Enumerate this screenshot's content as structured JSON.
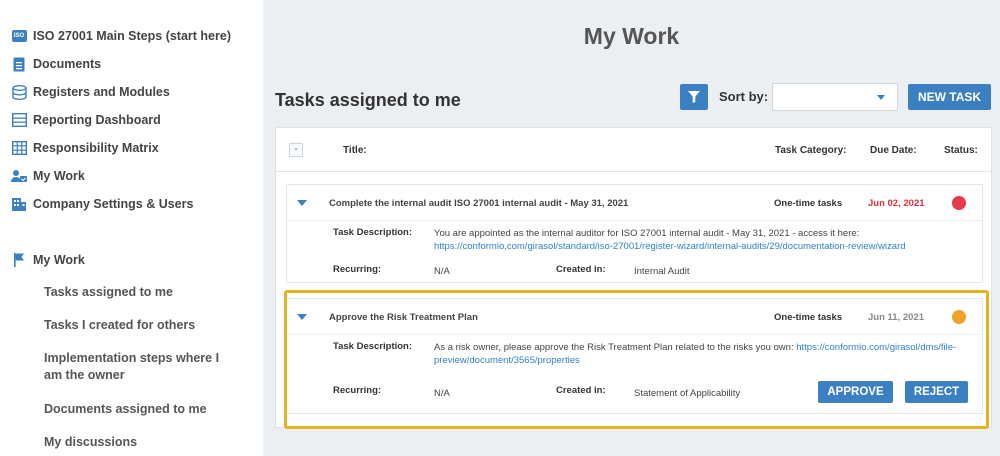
{
  "sidebar": {
    "nav": [
      {
        "label": "ISO 27001 Main Steps (start here)",
        "icon": "iso-badge-icon"
      },
      {
        "label": "Documents",
        "icon": "document-icon"
      },
      {
        "label": "Registers and Modules",
        "icon": "database-icon"
      },
      {
        "label": "Reporting Dashboard",
        "icon": "list-icon"
      },
      {
        "label": "Responsibility Matrix",
        "icon": "grid-icon"
      },
      {
        "label": "My Work",
        "icon": "user-check-icon"
      },
      {
        "label": "Company Settings & Users",
        "icon": "building-icon"
      }
    ],
    "iso_badge": "ISO",
    "section": {
      "label": "My Work",
      "icon": "flag-icon"
    },
    "sub_items": [
      "Tasks assigned to me",
      "Tasks I created for others",
      "Implementation steps where I am the owner",
      "Documents assigned to me",
      "My discussions"
    ]
  },
  "main": {
    "page_title": "My Work",
    "section_title": "Tasks assigned to me",
    "sort_label": "Sort by:",
    "sort_value": "",
    "new_task_label": "NEW TASK",
    "table": {
      "collapse_label": "-",
      "columns": {
        "title": "Title:",
        "category": "Task Category:",
        "due": "Due Date:",
        "status": "Status:"
      }
    },
    "tasks": [
      {
        "title": "Complete the internal audit ISO 27001 internal audit - May 31, 2021",
        "category": "One-time tasks",
        "due": "Jun 02, 2021",
        "due_color": "#e0303a",
        "status_color": "#e8394a",
        "desc_label": "Task Description:",
        "desc_text": "You are appointed as the internal auditor for ISO 27001 internal audit - May 31, 2021 - access it here:",
        "desc_link": "https://conformio.com/girasol/standard/iso-27001/register-wizard/internal-audits/29/documentation-review/wizard",
        "recurring_label": "Recurring:",
        "recurring": "N/A",
        "created_label": "Created in:",
        "created": "Internal Audit"
      },
      {
        "title": "Approve the Risk Treatment Plan",
        "category": "One-time tasks",
        "due": "Jun 11, 2021",
        "due_color": "#888888",
        "status_color": "#f0a32a",
        "desc_label": "Task Description:",
        "desc_text": "As a risk owner, please approve the Risk Treatment Plan related to the risks you own:",
        "desc_link_1": "https://conformio.com/girasol/dms/file-",
        "desc_link_2": "preview/document/3565/properties",
        "recurring_label": "Recurring:",
        "recurring": "N/A",
        "created_label": "Created in:",
        "created": "Statement of Applicability",
        "approve_label": "APPROVE",
        "reject_label": "REJECT"
      }
    ]
  },
  "colors": {
    "accent": "#3c80c3",
    "highlight": "#e8b21e",
    "link": "#2f7fd0"
  }
}
